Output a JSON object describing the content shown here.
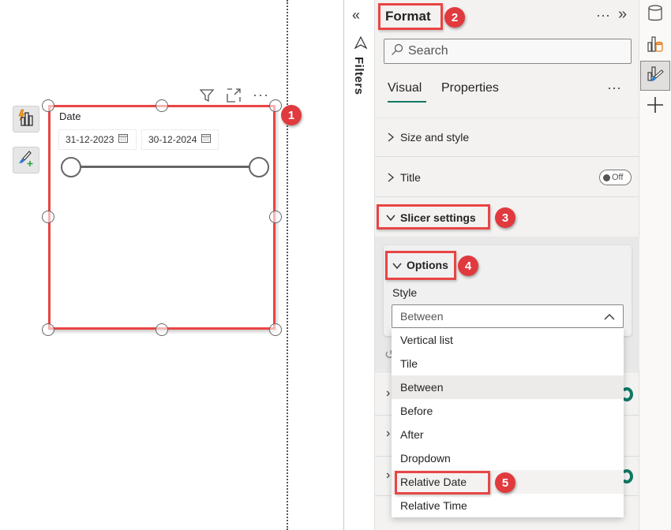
{
  "canvas": {
    "slicer": {
      "title": "Date",
      "start_date": "31-12-2023",
      "end_date": "30-12-2024"
    },
    "header_icons": [
      "filter-icon",
      "focus-mode-icon",
      "more-options-icon"
    ],
    "side_buttons": [
      "build-visual-icon",
      "format-visual-icon"
    ]
  },
  "filters_pane": {
    "label": "Filters",
    "collapse_icon": "double-chevron-left-icon",
    "filter_icon": "filter-icon"
  },
  "format_pane": {
    "title": "Format",
    "more_label": "···",
    "expand_label": "»",
    "search": {
      "placeholder": "Search"
    },
    "tabs": [
      {
        "label": "Visual",
        "active": true
      },
      {
        "label": "Properties",
        "active": false
      }
    ],
    "tabs_more": "···",
    "sections": [
      {
        "label": "Size and style",
        "expanded": false
      },
      {
        "label": "Title",
        "expanded": false,
        "toggle": "Off"
      },
      {
        "label": "Slicer settings",
        "expanded": true
      }
    ],
    "options": {
      "label": "Options",
      "style_label": "Style",
      "style_value": "Between",
      "style_options": [
        "Vertical list",
        "Tile",
        "Between",
        "Before",
        "After",
        "Dropdown",
        "Relative Date",
        "Relative Time"
      ],
      "selected_option": "Between",
      "hovered_option": "Relative Date"
    }
  },
  "annotations": [
    "1",
    "2",
    "3",
    "4",
    "5"
  ],
  "colors": {
    "highlight_red": "#e84545",
    "badge_red": "#e03a3e",
    "accent_green": "#117865"
  },
  "right_rail": [
    "data-icon",
    "build-visual-icon",
    "format-visual-icon",
    "add-icon"
  ]
}
